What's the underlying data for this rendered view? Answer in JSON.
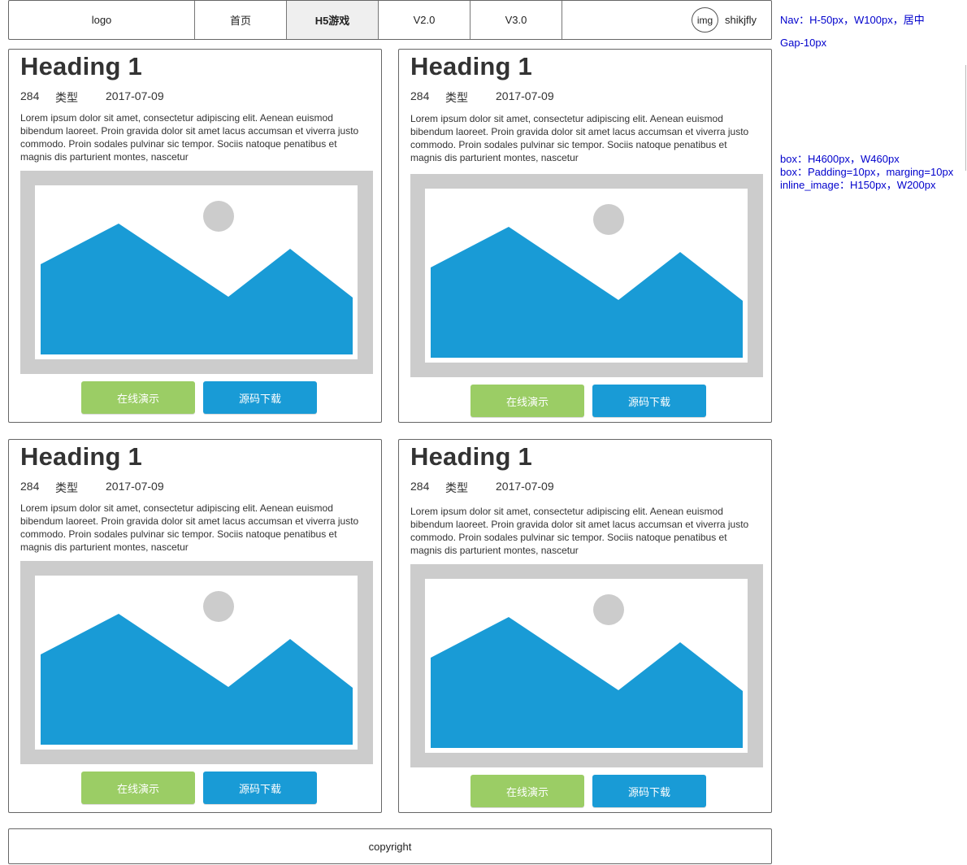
{
  "nav": {
    "logo": "logo",
    "items": [
      "首页",
      "H5游戏",
      "V2.0",
      "V3.0"
    ],
    "active_index": 1,
    "avatar": "img",
    "username": "shikjfly"
  },
  "notes": {
    "nav": "Nav：H-50px，W100px，居中",
    "gap": "Gap-10px",
    "box_size": "box：H4600px，W460px",
    "box_padding": "box：Padding=10px，marging=10px",
    "inline_image": "inline_image：H150px，W200px"
  },
  "cards": [
    {
      "heading": "Heading 1",
      "count": "284",
      "type": "类型",
      "date": "2017-07-09",
      "body": "Lorem ipsum dolor sit amet, consectetur adipiscing elit. Aenean euismod bibendum laoreet. Proin gravida dolor sit amet lacus accumsan et viverra justo commodo. Proin sodales pulvinar sic tempor. Sociis natoque penatibus et magnis dis parturient montes, nascetur",
      "demo_label": "在线演示",
      "download_label": "源码下载"
    },
    {
      "heading": "Heading 1",
      "count": "284",
      "type": "类型",
      "date": "2017-07-09",
      "body": "Lorem ipsum dolor sit amet, consectetur adipiscing elit. Aenean euismod bibendum laoreet. Proin gravida dolor sit amet lacus accumsan et viverra justo commodo. Proin sodales pulvinar sic tempor. Sociis natoque penatibus et magnis dis parturient montes, nascetur",
      "demo_label": "在线演示",
      "download_label": "源码下载"
    },
    {
      "heading": "Heading 1",
      "count": "284",
      "type": "类型",
      "date": "2017-07-09",
      "body": "Lorem ipsum dolor sit amet, consectetur adipiscing elit. Aenean euismod bibendum laoreet. Proin gravida dolor sit amet lacus accumsan et viverra justo commodo. Proin sodales pulvinar sic tempor. Sociis natoque penatibus et magnis dis parturient montes, nascetur",
      "demo_label": "在线演示",
      "download_label": "源码下载"
    },
    {
      "heading": "Heading 1",
      "count": "284",
      "type": "类型",
      "date": "2017-07-09",
      "body": "Lorem ipsum dolor sit amet, consectetur adipiscing elit. Aenean euismod bibendum laoreet. Proin gravida dolor sit amet lacus accumsan et viverra justo commodo. Proin sodales pulvinar sic tempor. Sociis natoque penatibus et magnis dis parturient montes, nascetur",
      "demo_label": "在线演示",
      "download_label": "源码下载"
    }
  ],
  "footer": {
    "text": "copyright"
  },
  "colors": {
    "demo_button": "#9bcd65",
    "download_button": "#199bd6",
    "image_placeholder": "#cccccc",
    "note_text": "#0000cc"
  },
  "icons": {
    "card_image": "image-placeholder-icon"
  }
}
